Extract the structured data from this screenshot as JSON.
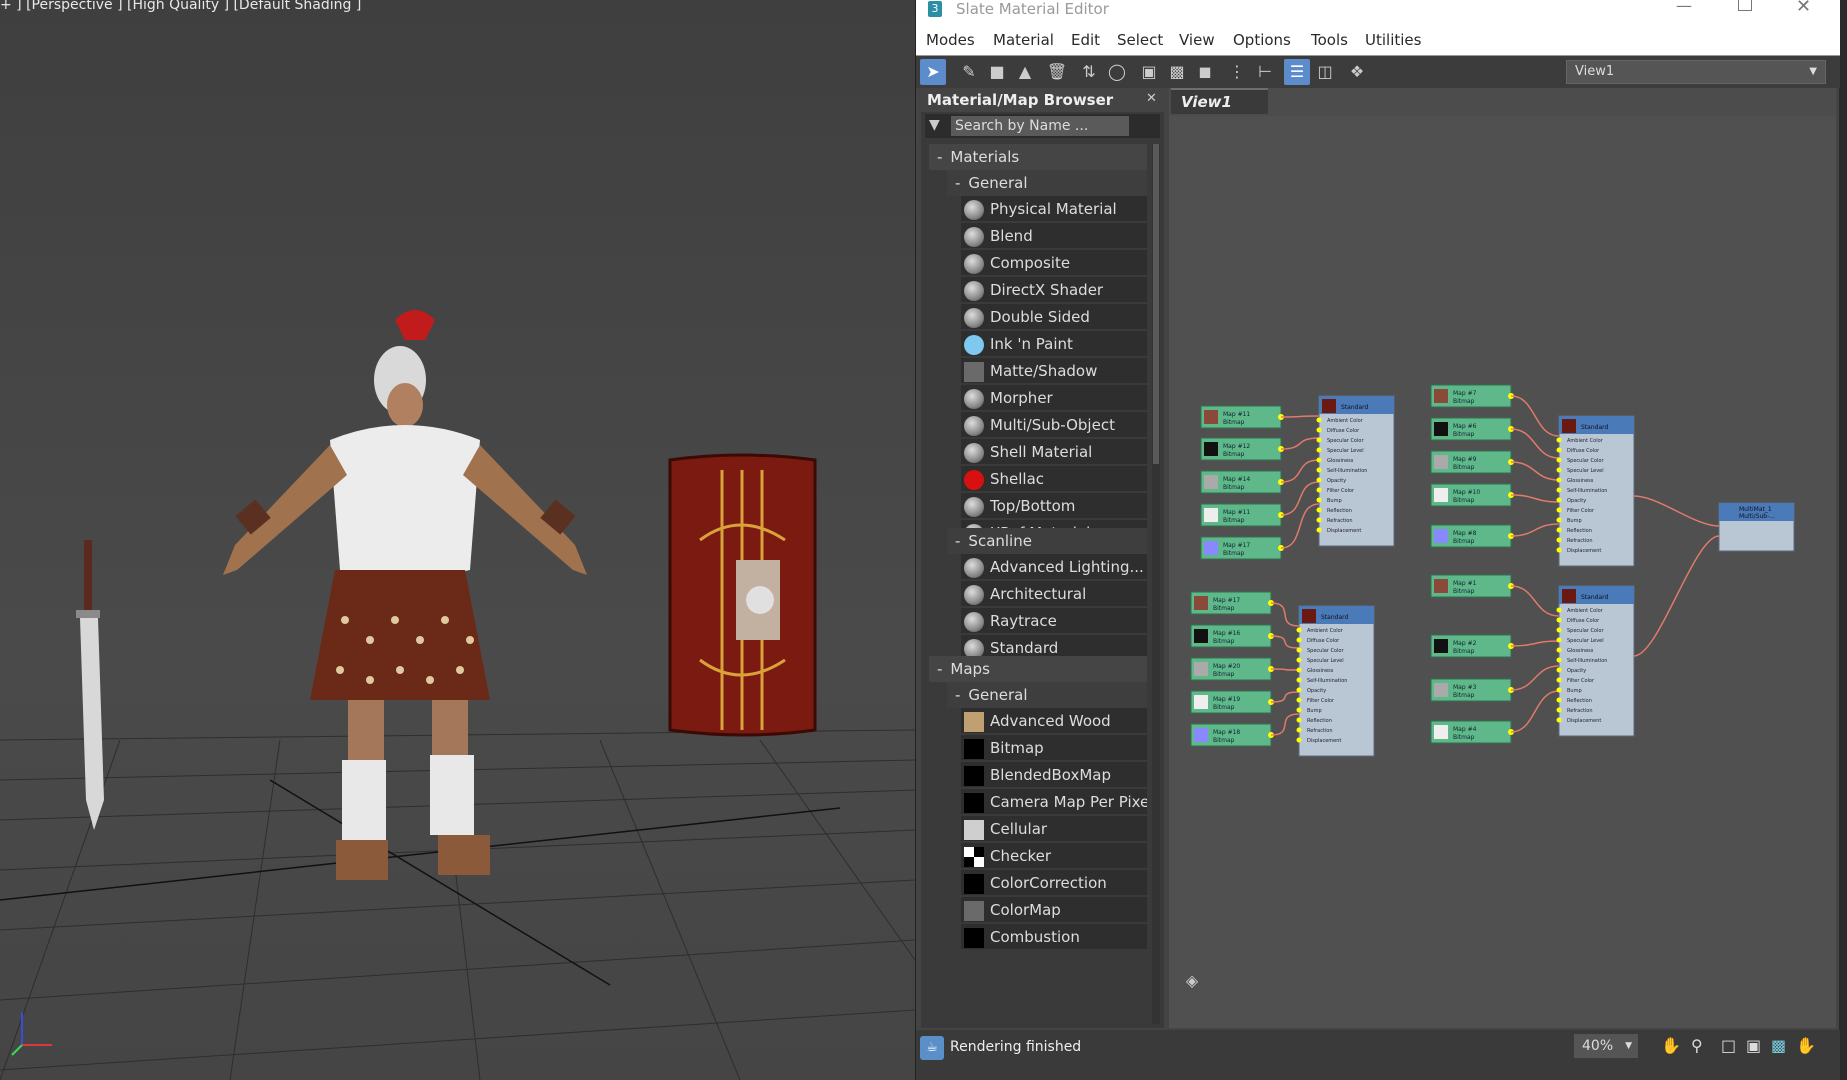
{
  "viewport": {
    "label": "+ ] [Perspective ] [High Quality ] [Default Shading ]"
  },
  "window": {
    "title": "Slate Material Editor"
  },
  "menu": [
    "Modes",
    "Material",
    "Edit",
    "Select",
    "View",
    "Options",
    "Tools",
    "Utilities"
  ],
  "toolbar": {
    "view_select": "View1"
  },
  "browser": {
    "title": "Material/Map Browser",
    "search_placeholder": "Search by Name ...",
    "materials_label": "Materials",
    "general_label": "General",
    "general_items": [
      {
        "label": "Physical Material",
        "swatch": "#8a8a8a"
      },
      {
        "label": "Blend",
        "swatch": "#8a8a8a"
      },
      {
        "label": "Composite",
        "swatch": "#8a8a8a"
      },
      {
        "label": "DirectX Shader",
        "swatch": "#8a8a8a"
      },
      {
        "label": "Double Sided",
        "swatch": "#8a8a8a"
      },
      {
        "label": "Ink 'n Paint",
        "swatch": "#7fc8f0"
      },
      {
        "label": "Matte/Shadow",
        "swatch": "#6a6a6a"
      },
      {
        "label": "Morpher",
        "swatch": "#8a8a8a"
      },
      {
        "label": "Multi/Sub-Object",
        "swatch": "#8a8a8a"
      },
      {
        "label": "Shell Material",
        "swatch": "#8a8a8a"
      },
      {
        "label": "Shellac",
        "swatch": "#d81010"
      },
      {
        "label": "Top/Bottom",
        "swatch": "#8a8a8a"
      },
      {
        "label": "XRef Material",
        "swatch": "#9a9a9a"
      }
    ],
    "scanline_label": "Scanline",
    "scanline_items": [
      {
        "label": "Advanced Lighting...",
        "swatch": "#8a8a8a"
      },
      {
        "label": "Architectural",
        "swatch": "#8a8a8a"
      },
      {
        "label": "Raytrace",
        "swatch": "#8a8a8a"
      },
      {
        "label": "Standard",
        "swatch": "#8a8a8a"
      }
    ],
    "maps_label": "Maps",
    "maps_general_label": "General",
    "map_items": [
      {
        "label": "Advanced Wood",
        "swatch": "#c0a070"
      },
      {
        "label": "Bitmap",
        "swatch": "#000000"
      },
      {
        "label": "BlendedBoxMap",
        "swatch": "#000000"
      },
      {
        "label": "Camera Map Per Pixel",
        "swatch": "#000000"
      },
      {
        "label": "Cellular",
        "swatch": "#cfcfcf"
      },
      {
        "label": "Checker",
        "swatch": "checker"
      },
      {
        "label": "ColorCorrection",
        "swatch": "#000000"
      },
      {
        "label": "ColorMap",
        "swatch": "#6a6a6a"
      },
      {
        "label": "Combustion",
        "swatch": "#000000"
      }
    ]
  },
  "view": {
    "tab_label": "View1"
  },
  "nodes": {
    "map_nodes": [
      {
        "name": "Map #11",
        "type": "Bitmap"
      },
      {
        "name": "Map #12",
        "type": "Bitmap"
      },
      {
        "name": "Map #14",
        "type": "Bitmap"
      },
      {
        "name": "Map #11",
        "type": "Bitmap"
      },
      {
        "name": "Map #17",
        "type": "Bitmap"
      },
      {
        "name": "Map #17",
        "type": "Bitmap"
      },
      {
        "name": "Map #16",
        "type": "Bitmap"
      },
      {
        "name": "Map #20",
        "type": "Bitmap"
      },
      {
        "name": "Map #19",
        "type": "Bitmap"
      },
      {
        "name": "Map #18",
        "type": "Bitmap"
      },
      {
        "name": "Map #7",
        "type": "Bitmap"
      },
      {
        "name": "Map #6",
        "type": "Bitmap"
      },
      {
        "name": "Map #9",
        "type": "Bitmap"
      },
      {
        "name": "Map #10",
        "type": "Bitmap"
      },
      {
        "name": "Map #8",
        "type": "Bitmap"
      },
      {
        "name": "Map #1",
        "type": "Bitmap"
      },
      {
        "name": "Map #2",
        "type": "Bitmap"
      },
      {
        "name": "Map #3",
        "type": "Bitmap"
      },
      {
        "name": "Map #4",
        "type": "Bitmap"
      }
    ],
    "material_slots": [
      "Ambient Color",
      "Diffuse Color",
      "Specular Color",
      "Specular Level",
      "Glossiness",
      "Self-Illumination",
      "Opacity",
      "Filter Color",
      "Bump",
      "Reflection",
      "Refraction",
      "Displacement"
    ],
    "material_type": "Standard",
    "multi_node": {
      "name": "MultiMat_1",
      "type": "Multi/Sub-..."
    }
  },
  "status": {
    "text": "Rendering finished",
    "zoom": "40%"
  }
}
